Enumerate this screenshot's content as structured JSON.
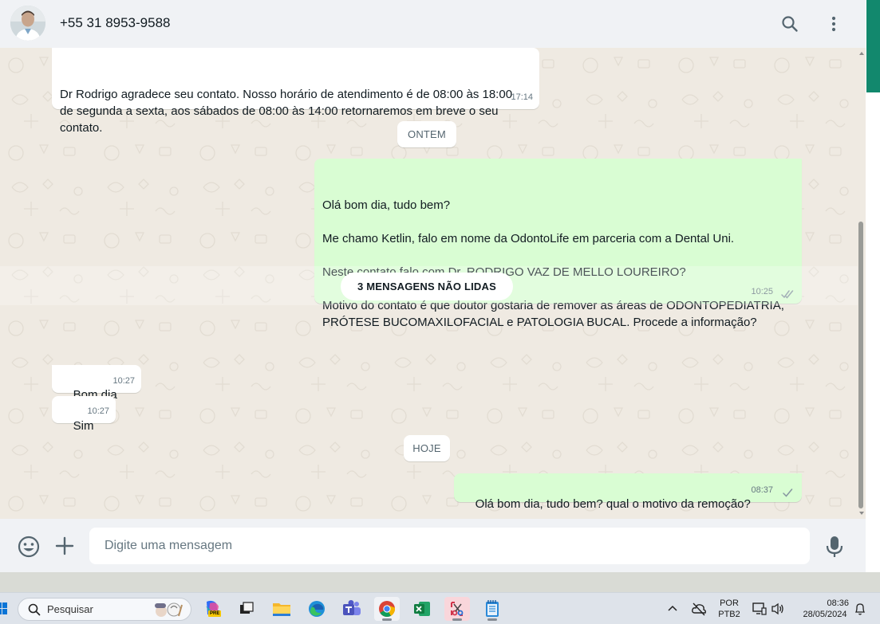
{
  "header": {
    "contact_name": "+55 31 8953-9588"
  },
  "messages": [
    {
      "direction": "incoming",
      "text": "Dr Rodrigo agradece seu contato. Nosso horário de atendimento é de 08:00 às 18:00\nde segunda a sexta, aos sábados de 08:00 às 14:00 retornaremos em breve o seu\ncontato.",
      "time": "17:14"
    },
    {
      "direction": "outgoing",
      "text": "Olá bom dia, tudo bem?\n\nMe chamo Ketlin, falo em nome da OdontoLife em parceria com a Dental Uni.\n\nNeste contato falo com Dr. RODRIGO VAZ DE MELLO LOUREIRO?\n\nMotivo do contato é que doutor gostaria de remover as áreas de ODONTOPEDIATRIA,\nPRÓTESE BUCOMAXILOFACIAL e PATOLOGIA BUCAL. Procede a informação?",
      "time": "10:25",
      "status": "read"
    },
    {
      "direction": "incoming",
      "text": "Bom dia",
      "time": "10:27"
    },
    {
      "direction": "incoming",
      "text": "Sim",
      "time": "10:27"
    },
    {
      "direction": "outgoing",
      "text": "Olá bom dia, tudo bem? qual o motivo da remoção?",
      "time": "08:37",
      "status": "sent"
    }
  ],
  "date_chips": [
    "ONTEM",
    "HOJE"
  ],
  "unread_label": "3 MENSAGENS NÃO LIDAS",
  "composer": {
    "placeholder": "Digite uma mensagem"
  },
  "taskbar": {
    "search_label": "Pesquisar",
    "copilot_badge": "PRE",
    "language_line1": "POR",
    "language_line2": "PTB2",
    "clock_time": "08:36",
    "clock_date": "28/05/2024"
  },
  "colors": {
    "incoming_bubble": "#ffffff",
    "outgoing_bubble": "#d9fdd3",
    "read_tick": "#53bdeb",
    "chat_background": "#efeae2",
    "accent_green": "#12886d"
  },
  "icons": {
    "header": [
      "search-icon",
      "more-vertical-icon"
    ],
    "composer": [
      "emoji-icon",
      "plus-icon",
      "microphone-icon"
    ]
  }
}
